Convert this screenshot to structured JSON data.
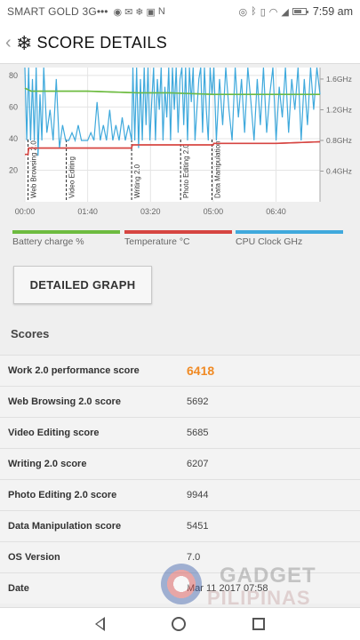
{
  "status_bar": {
    "carrier": "SMART GOLD 3G",
    "dots": "•••",
    "notif_icons": [
      "messenger-icon",
      "mail-icon",
      "snowflake-icon",
      "image-icon",
      "n-icon"
    ],
    "right_icons": [
      "hotspot-icon",
      "bluetooth-icon",
      "vibrate-icon",
      "wifi-icon",
      "signal-icon"
    ],
    "time": "7:59 am"
  },
  "app_bar": {
    "back_glyph": "‹",
    "icon": "❄",
    "title": "SCORE DETAILS"
  },
  "chart_data": {
    "type": "line",
    "x_ticks": [
      "00:00",
      "01:40",
      "03:20",
      "05:00",
      "06:40"
    ],
    "y_left_ticks": [
      "80",
      "60",
      "40",
      "20"
    ],
    "y_left_range": [
      0,
      85
    ],
    "y_right_ticks": [
      "1.6GHz",
      "1.2GHz",
      "0.8GHz",
      "0.4GHz"
    ],
    "y_right_range": [
      0,
      1.75
    ],
    "x_range_seconds": [
      0,
      470
    ],
    "section_markers": [
      {
        "label": "Web Browsing 2.0",
        "t": 5
      },
      {
        "label": "Video Editing",
        "t": 66
      },
      {
        "label": "Writing 2.0",
        "t": 170
      },
      {
        "label": "Photo Editing 2.0",
        "t": 248
      },
      {
        "label": "Data Manipulation",
        "t": 298
      }
    ],
    "series": [
      {
        "name": "Battery charge %",
        "color": "#6dbb3f",
        "x": [
          0,
          10,
          60,
          100,
          180,
          230,
          300,
          360,
          470
        ],
        "y": [
          72,
          70,
          70,
          70,
          69,
          69,
          68,
          68,
          68
        ]
      },
      {
        "name": "Temperature °C",
        "color": "#d64541",
        "x": [
          0,
          5,
          6,
          60,
          170,
          171,
          230,
          300,
          301,
          400,
          470
        ],
        "y": [
          30,
          30,
          34,
          34,
          34,
          36,
          36,
          36,
          37,
          37,
          38
        ]
      },
      {
        "name": "CPU Clock GHz",
        "color": "#3fa9dc",
        "x": [
          0,
          3,
          6,
          9,
          12,
          15,
          18,
          21,
          24,
          27,
          30,
          35,
          40,
          45,
          50,
          55,
          60,
          65,
          70,
          75,
          80,
          85,
          90,
          95,
          100,
          105,
          110,
          115,
          120,
          125,
          130,
          135,
          140,
          145,
          150,
          155,
          160,
          165,
          170,
          172,
          175,
          178,
          181,
          184,
          187,
          190,
          193,
          196,
          199,
          202,
          205,
          208,
          211,
          214,
          217,
          220,
          223,
          226,
          229,
          232,
          235,
          238,
          241,
          244,
          247,
          250,
          253,
          256,
          259,
          262,
          265,
          268,
          271,
          274,
          277,
          280,
          283,
          286,
          289,
          292,
          295,
          298,
          301,
          305,
          310,
          315,
          320,
          325,
          330,
          335,
          340,
          345,
          350,
          355,
          360,
          365,
          370,
          375,
          380,
          385,
          390,
          395,
          400,
          405,
          410,
          415,
          420,
          425,
          430,
          435,
          440,
          445,
          450,
          455,
          460,
          465,
          470
        ],
        "y": [
          1.75,
          0.8,
          1.75,
          0.8,
          1.6,
          0.8,
          1.75,
          0.6,
          1.4,
          0.8,
          1.75,
          0.9,
          1.2,
          0.8,
          1.6,
          0.7,
          1.0,
          0.8,
          0.8,
          0.9,
          0.8,
          1.0,
          0.8,
          0.8,
          0.8,
          0.9,
          0.8,
          1.3,
          0.8,
          1.0,
          0.8,
          1.2,
          0.8,
          1.0,
          0.8,
          1.1,
          0.8,
          1.0,
          0.8,
          1.75,
          0.8,
          1.75,
          0.7,
          1.6,
          0.8,
          1.75,
          1.0,
          1.75,
          0.8,
          1.3,
          1.75,
          0.8,
          1.6,
          1.2,
          1.75,
          0.8,
          1.5,
          1.1,
          1.75,
          0.8,
          1.75,
          1.2,
          1.75,
          0.9,
          1.6,
          1.75,
          1.0,
          1.75,
          0.8,
          1.75,
          1.3,
          1.75,
          0.8,
          1.2,
          1.6,
          1.75,
          0.9,
          1.75,
          1.2,
          0.8,
          1.75,
          1.4,
          1.75,
          0.8,
          1.6,
          1.0,
          1.75,
          1.2,
          0.8,
          1.75,
          1.1,
          1.6,
          0.9,
          1.75,
          1.3,
          0.8,
          1.6,
          1.0,
          1.75,
          0.9,
          1.4,
          1.75,
          0.8,
          1.5,
          1.1,
          1.75,
          0.9,
          1.6,
          1.2,
          1.75,
          0.8,
          1.6,
          1.0,
          1.75,
          1.2,
          1.75,
          1.4
        ]
      }
    ]
  },
  "legend": [
    {
      "label": "Battery charge %",
      "color": "#6dbb3f"
    },
    {
      "label": "Temperature °C",
      "color": "#d64541"
    },
    {
      "label": "CPU Clock GHz",
      "color": "#3fa9dc"
    }
  ],
  "detail_button": "DETAILED GRAPH",
  "scores": {
    "header": "Scores",
    "rows": [
      {
        "label": "Work 2.0 performance score",
        "value": "6418"
      },
      {
        "label": "Web Browsing 2.0 score",
        "value": "5692"
      },
      {
        "label": "Video Editing score",
        "value": "5685"
      },
      {
        "label": "Writing 2.0 score",
        "value": "6207"
      },
      {
        "label": "Photo Editing 2.0 score",
        "value": "9944"
      },
      {
        "label": "Data Manipulation score",
        "value": "5451"
      },
      {
        "label": "OS Version",
        "value": "7.0"
      },
      {
        "label": "Date",
        "value": "Mar 11 2017 07:58"
      }
    ]
  },
  "watermark": {
    "line1": "GADGET",
    "line2": "PILIPINAS"
  }
}
